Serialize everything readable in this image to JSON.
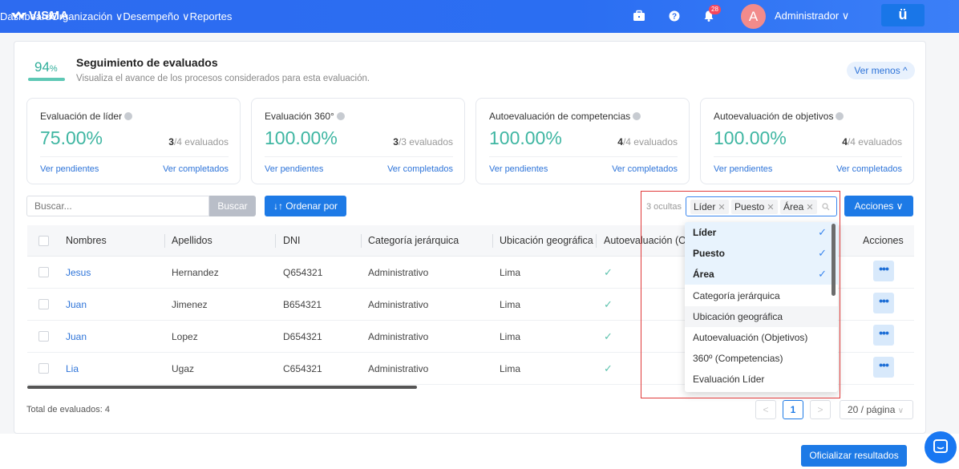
{
  "topbar": {
    "brand": "VISMA",
    "nav": [
      "Dashboard",
      "Organización ∨",
      "Desempeño ∨",
      "Reportes"
    ],
    "notification_count": "28",
    "avatar_letter": "A",
    "user": "Administrador ∨",
    "app_button": "ü"
  },
  "header": {
    "percent_value": "94",
    "percent_sign": "%",
    "progress_fraction": 0.94,
    "title": "Seguimiento de evaluados",
    "subtitle": "Visualiza el avance de los procesos considerados para esta evaluación.",
    "toggle": "Ver menos ^"
  },
  "stats": [
    {
      "title": "Evaluación de líder",
      "value": "75.00%",
      "done": "3",
      "total": "/4 evaluados",
      "pending": "Ver pendientes",
      "completed": "Ver completados"
    },
    {
      "title": "Evaluación 360°",
      "value": "100.00%",
      "done": "3",
      "total": "/3 evaluados",
      "pending": "Ver pendientes",
      "completed": "Ver completados"
    },
    {
      "title": "Autoevaluación de competencias",
      "value": "100.00%",
      "done": "4",
      "total": "/4 evaluados",
      "pending": "Ver pendientes",
      "completed": "Ver completados"
    },
    {
      "title": "Autoevaluación de objetivos",
      "value": "100.00%",
      "done": "4",
      "total": "/4 evaluados",
      "pending": "Ver pendientes",
      "completed": "Ver completados"
    }
  ],
  "toolbar": {
    "search_placeholder": "Buscar...",
    "search_button": "Buscar",
    "sort_button": "↓↑ Ordenar por",
    "hidden_count": "3 ocultas",
    "tags": [
      "Líder",
      "Puesto",
      "Área"
    ],
    "actions_button": "Acciones ∨"
  },
  "table": {
    "columns": [
      "Nombres",
      "Apellidos",
      "DNI",
      "Categoría jerárquica",
      "Ubicación geográfica",
      "Autoevaluación (Ob",
      "Acciones"
    ],
    "rows": [
      {
        "name": "Jesus",
        "last": "Hernandez",
        "dni": "Q654321",
        "cat": "Administrativo",
        "loc": "Lima"
      },
      {
        "name": "Juan",
        "last": "Jimenez",
        "dni": "B654321",
        "cat": "Administrativo",
        "loc": "Lima"
      },
      {
        "name": "Juan",
        "last": "Lopez",
        "dni": "D654321",
        "cat": "Administrativo",
        "loc": "Lima"
      },
      {
        "name": "Lia",
        "last": "Ugaz",
        "dni": "C654321",
        "cat": "Administrativo",
        "loc": "Lima"
      }
    ],
    "check_mark": "✓",
    "row_action": "•••"
  },
  "dropdown": {
    "options": [
      {
        "label": "Líder",
        "selected": true
      },
      {
        "label": "Puesto",
        "selected": true
      },
      {
        "label": "Área",
        "selected": true
      },
      {
        "label": "Categoría jerárquica",
        "selected": false
      },
      {
        "label": "Ubicación geográfica",
        "selected": false
      },
      {
        "label": "Autoevaluación (Objetivos)",
        "selected": false
      },
      {
        "label": "360º (Competencias)",
        "selected": false
      },
      {
        "label": "Evaluación Líder",
        "selected": false
      }
    ],
    "check": "✓"
  },
  "footer": {
    "total": "Total de evaluados: 4",
    "prev": "<",
    "page": "1",
    "next": ">",
    "per_page": "20 / página",
    "per_page_caret": "∨",
    "official_button": "Oficializar resultados"
  },
  "colors": {
    "accent": "#1d7ae6",
    "success": "#3fb6a2",
    "highlight_box": "#e03a3a"
  }
}
